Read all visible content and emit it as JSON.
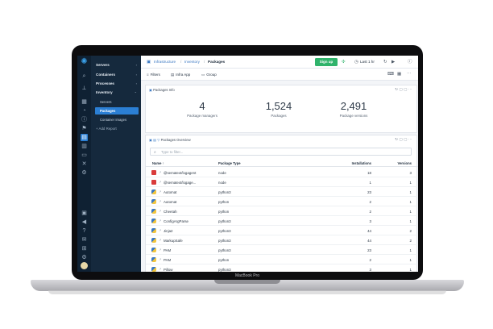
{
  "device_label": "MacBook Pro",
  "rail": {
    "icons": [
      "search-icon",
      "pin-icon",
      "grid-icon",
      "dashboard-icon",
      "info-icon",
      "flag-icon",
      "inventory-icon",
      "layout-icon",
      "doc-icon",
      "tools-icon",
      "settings-icon",
      "gift-icon",
      "megaphone-icon",
      "help-icon",
      "mail-icon",
      "apps-icon",
      "gear-icon"
    ]
  },
  "nav": {
    "items": [
      {
        "label": "Servers",
        "chevron": "›"
      },
      {
        "label": "Containers",
        "chevron": "›"
      },
      {
        "label": "Processes",
        "chevron": "›"
      },
      {
        "label": "Inventory",
        "chevron": "⌄"
      }
    ],
    "subitems": [
      "Servers",
      "Packages",
      "Container Images"
    ],
    "active_sub": "Packages",
    "add_report": "+ Add Report"
  },
  "breadcrumb": [
    "Infrastructure",
    "Inventory",
    "Packages"
  ],
  "topbar": {
    "signup": "Sign up",
    "time_range": "Last 1 hr"
  },
  "toolbar": {
    "filters": "Filters",
    "infra_app": "Infra App",
    "group": "Group"
  },
  "packages_info": {
    "title": "Packages Info",
    "stats": [
      {
        "value": "4",
        "label": "Package managers"
      },
      {
        "value": "1,524",
        "label": "Packages"
      },
      {
        "value": "2,491",
        "label": "Package versions"
      }
    ]
  },
  "overview": {
    "title": "Packages Overview",
    "filter_placeholder": "Type to filter...",
    "columns": [
      "Name ↑",
      "Package Type",
      "Installations",
      "Versions"
    ],
    "rows": [
      {
        "icon": "node",
        "name": "@sematext/logagent",
        "type": "node",
        "installs": "18",
        "versions": "3"
      },
      {
        "icon": "node",
        "name": "@sematext/logage...",
        "type": "node",
        "installs": "1",
        "versions": "1"
      },
      {
        "icon": "py",
        "name": "Automat",
        "type": "python3",
        "installs": "23",
        "versions": "1"
      },
      {
        "icon": "py",
        "name": "Automat",
        "type": "python",
        "installs": "2",
        "versions": "1"
      },
      {
        "icon": "py",
        "name": "Cheetah",
        "type": "python",
        "installs": "2",
        "versions": "1"
      },
      {
        "icon": "py",
        "name": "ConfigArgParse",
        "type": "python3",
        "installs": "3",
        "versions": "1"
      },
      {
        "icon": "py",
        "name": "Jinja2",
        "type": "python3",
        "installs": "44",
        "versions": "2"
      },
      {
        "icon": "py",
        "name": "MarkupSafe",
        "type": "python3",
        "installs": "44",
        "versions": "2"
      },
      {
        "icon": "py",
        "name": "PAM",
        "type": "python3",
        "installs": "23",
        "versions": "1"
      },
      {
        "icon": "py",
        "name": "PAM",
        "type": "python",
        "installs": "2",
        "versions": "1"
      },
      {
        "icon": "py",
        "name": "Pillow",
        "type": "python3",
        "installs": "3",
        "versions": "1"
      }
    ]
  }
}
